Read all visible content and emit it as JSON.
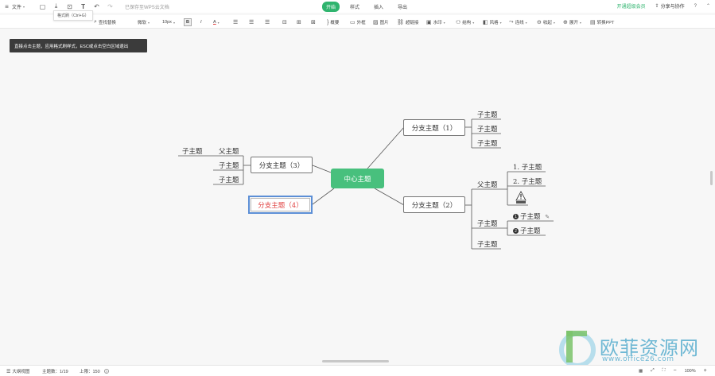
{
  "topbar": {
    "file_menu": "文件",
    "saved_status": "已保存至WPS云文档",
    "tabs": [
      "开始",
      "样式",
      "插入",
      "导出"
    ],
    "vip": "开通超级会员",
    "share": "分享与协作",
    "help": "?"
  },
  "tooltip": "格式刷（Ctrl+G）",
  "toolbar": {
    "find_replace": "查找替换",
    "font": "微软",
    "font_size": "10px",
    "bold": "B",
    "italic": "I",
    "font_color": "A",
    "summary": "概要",
    "frame": "外框",
    "image": "图片",
    "link": "超链接",
    "watermark": "水印",
    "structure": "结构",
    "style": "风格",
    "lines": "连线",
    "collapse": "收起",
    "expand": "展开",
    "to_ppt": "转换PPT"
  },
  "hint": "直接点击主题，应用格式刷样式，ESC或点击空白区域退出",
  "mindmap": {
    "center": "中心主题",
    "branch1": "分支主题（1）",
    "branch2": "分支主题（2）",
    "branch3": "分支主题（3）",
    "branch4": "分支主题（4）",
    "b1_children": [
      "子主题",
      "子主题",
      "子主题"
    ],
    "b2_parent": "父主题",
    "b2_numbered": [
      "1. 子主题",
      "2. 子主题"
    ],
    "b2_child": "子主题",
    "b2_badged": [
      {
        "badge": "1",
        "label": "子主题"
      },
      {
        "badge": "2",
        "label": "子主题"
      }
    ],
    "b2_last": "子主题",
    "b3_parent": "父主题",
    "b3_parent_child": "子主题",
    "b3_children": [
      "子主题",
      "子主题"
    ]
  },
  "statusbar": {
    "outline": "大纲视图",
    "topic_count": "主题数：1/19",
    "limit": "上限：150",
    "zoom": "100%"
  },
  "watermark": {
    "title": "欧菲资源网",
    "url": "www.office26.com"
  },
  "colors": {
    "accent": "#2fb46e",
    "center_node": "#48c07d",
    "selected_border": "#5c8fd6",
    "selected_text": "#e04040"
  }
}
